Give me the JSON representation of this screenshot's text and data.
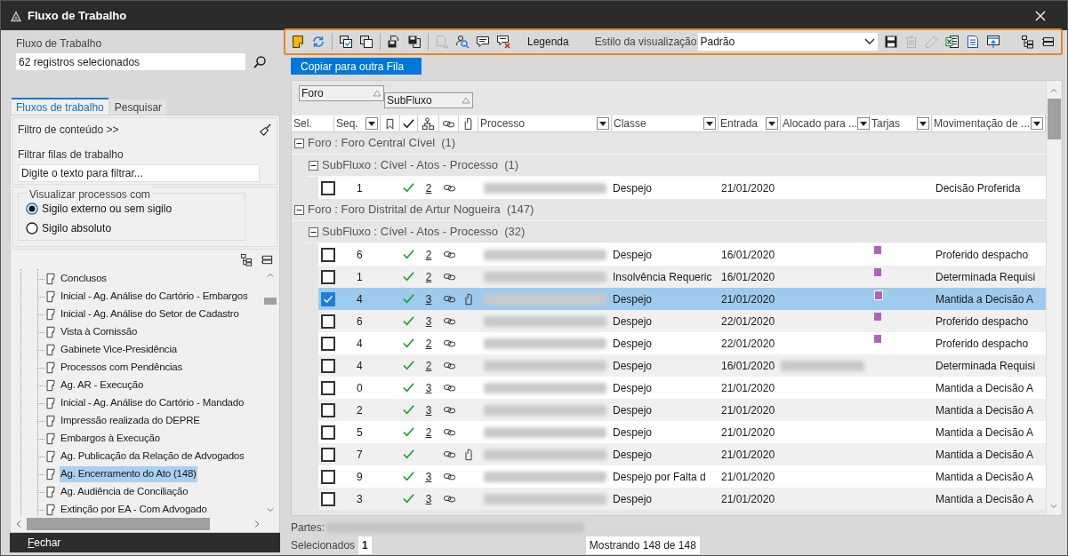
{
  "window": {
    "title": "Fluxo de Trabalho"
  },
  "left_panel": {
    "workflow_label": "Fluxo de Trabalho",
    "workflow_value": "62 registros selecionados",
    "tabs": [
      {
        "label": "Fluxos de trabalho",
        "selected": true
      },
      {
        "label": "Pesquisar",
        "selected": false
      }
    ],
    "content_filter": "Filtro de conteúdo >>",
    "queue_filter_label": "Filtrar filas de trabalho",
    "queue_filter": {
      "placeholder": "Digite o texto para filtrar..."
    },
    "visibility": {
      "legend": "Visualizar processos com",
      "options": [
        {
          "label": "Sigilo externo ou sem sigilo",
          "selected": true
        },
        {
          "label": "Sigilo absoluto",
          "selected": false
        }
      ]
    },
    "queues": [
      {
        "label": "Conclusos",
        "selected": false
      },
      {
        "label": "Inicial - Ag. Análise do Cartório - Embargos",
        "selected": false
      },
      {
        "label": "Inicial - Ag. Análise do Setor de Cadastro",
        "selected": false
      },
      {
        "label": "Vista à Comissão",
        "selected": false
      },
      {
        "label": "Gabinete Vice-Presidência",
        "selected": false
      },
      {
        "label": "Processos com Pendências",
        "selected": false
      },
      {
        "label": "Ag. AR - Execução",
        "selected": false
      },
      {
        "label": "Inicial - Ag. Análise do Cartório - Mandado",
        "selected": false
      },
      {
        "label": "Impressão realizada do DEPRE",
        "selected": false
      },
      {
        "label": "Embargos à Execução",
        "selected": false
      },
      {
        "label": "Ag. Publicação da Relação de Advogados",
        "selected": false
      },
      {
        "label": "Ag. Encerramento do Ato (148)",
        "selected": true
      },
      {
        "label": "Ag. Audiência de Conciliação",
        "selected": false
      },
      {
        "label": "Extinção por EA - Com Advogado",
        "selected": false
      }
    ],
    "close_button": "Fechar"
  },
  "toolbar": {
    "icons_left": [
      {
        "disabled": false
      },
      {
        "disabled": false
      },
      {
        "disabled": false
      },
      {
        "disabled": false
      },
      {
        "disabled": false
      },
      {
        "disabled": false
      },
      {
        "disabled": true
      },
      {
        "disabled": false
      },
      {
        "disabled": false
      },
      {
        "disabled": false
      }
    ],
    "legend_button": "Legenda",
    "style_label": "Estilo da visualização",
    "style_value": "Padrão",
    "icons_right": [
      {
        "disabled": false
      },
      {
        "disabled": true
      },
      {
        "disabled": true
      },
      {
        "disabled": false
      },
      {
        "disabled": false
      },
      {
        "disabled": false
      }
    ],
    "icons_far": [
      {
        "disabled": false
      },
      {
        "disabled": false
      }
    ]
  },
  "copy_button": "Copiar para outra Fila",
  "grouping": [
    "Foro",
    "SubFluxo"
  ],
  "table": {
    "columns": [
      {
        "kind": "text",
        "label": "Sel.",
        "filter": false
      },
      {
        "kind": "text",
        "label": "Seq.",
        "filter": true
      },
      {
        "kind": "icon"
      },
      {
        "kind": "icon"
      },
      {
        "kind": "icon"
      },
      {
        "kind": "icon"
      },
      {
        "kind": "icon"
      },
      {
        "kind": "text",
        "label": "Processo",
        "filter": true
      },
      {
        "kind": "text",
        "label": "Classe",
        "filter": true
      },
      {
        "kind": "text",
        "label": "Entrada",
        "filter": true
      },
      {
        "kind": "text",
        "label": "Alocado para ...",
        "filter": true
      },
      {
        "kind": "text",
        "label": "Tarjas",
        "filter": true
      },
      {
        "kind": "text",
        "label": "Movimentação de ...",
        "filter": true
      }
    ],
    "groups": [
      {
        "label": "Foro : Foro Central Cível",
        "count": "(1)",
        "expanded": true,
        "children": [
          {
            "label": "SubFluxo : Cível - Atos - Processo",
            "count": "(1)",
            "expanded": true,
            "rows": [
              {
                "seq": "1",
                "checked": false,
                "done": true,
                "volumes": "2",
                "linked": true,
                "attachment": false,
                "classe": "Despejo",
                "entrada": "21/01/2020",
                "allocated": false,
                "tarja": false,
                "movimentacao": "Decisão Proferida",
                "selected": false
              }
            ]
          }
        ]
      },
      {
        "label": "Foro : Foro Distrital de Artur Nogueira",
        "count": "(147)",
        "expanded": true,
        "children": [
          {
            "label": "SubFluxo : Cível - Atos - Processo",
            "count": "(32)",
            "expanded": true,
            "rows": [
              {
                "seq": "6",
                "checked": false,
                "done": true,
                "volumes": "2",
                "linked": true,
                "attachment": false,
                "classe": "Despejo",
                "entrada": "16/01/2020",
                "allocated": false,
                "tarja": true,
                "movimentacao": "Proferido despacho",
                "selected": false
              },
              {
                "seq": "1",
                "checked": false,
                "done": true,
                "volumes": "2",
                "linked": true,
                "attachment": false,
                "classe": "Insolvência Requeric",
                "entrada": "16/01/2020",
                "allocated": false,
                "tarja": true,
                "movimentacao": "Determinada Requisi",
                "selected": false
              },
              {
                "seq": "4",
                "checked": true,
                "done": true,
                "volumes": "3",
                "linked": true,
                "attachment": true,
                "classe": "Despejo",
                "entrada": "21/01/2020",
                "allocated": false,
                "tarja": true,
                "movimentacao": "Mantida a Decisão A",
                "selected": true
              },
              {
                "seq": "6",
                "checked": false,
                "done": true,
                "volumes": "3",
                "linked": true,
                "attachment": false,
                "classe": "Despejo",
                "entrada": "22/01/2020",
                "allocated": false,
                "tarja": true,
                "movimentacao": "Proferido despacho",
                "selected": false
              },
              {
                "seq": "4",
                "checked": false,
                "done": true,
                "volumes": "2",
                "linked": true,
                "attachment": false,
                "classe": "Despejo",
                "entrada": "22/01/2020",
                "allocated": false,
                "tarja": true,
                "movimentacao": "Proferido despacho",
                "selected": false
              },
              {
                "seq": "4",
                "checked": false,
                "done": true,
                "volumes": "2",
                "linked": true,
                "attachment": false,
                "classe": "Despejo",
                "entrada": "16/01/2020",
                "allocated": true,
                "tarja": false,
                "movimentacao": "Determinada Requisi",
                "selected": false
              },
              {
                "seq": "0",
                "checked": false,
                "done": true,
                "volumes": "3",
                "linked": true,
                "attachment": false,
                "classe": "Despejo",
                "entrada": "21/01/2020",
                "allocated": false,
                "tarja": false,
                "movimentacao": "Mantida a Decisão A",
                "selected": false
              },
              {
                "seq": "2",
                "checked": false,
                "done": true,
                "volumes": "3",
                "linked": true,
                "attachment": false,
                "classe": "Despejo",
                "entrada": "21/01/2020",
                "allocated": false,
                "tarja": false,
                "movimentacao": "Mantida a Decisão A",
                "selected": false
              },
              {
                "seq": "5",
                "checked": false,
                "done": true,
                "volumes": "2",
                "linked": true,
                "attachment": false,
                "classe": "Despejo",
                "entrada": "21/01/2020",
                "allocated": false,
                "tarja": false,
                "movimentacao": "Mantida a Decisão A",
                "selected": false
              },
              {
                "seq": "7",
                "checked": false,
                "done": true,
                "linked": true,
                "attachment": true,
                "classe": "Despejo",
                "entrada": "21/01/2020",
                "allocated": false,
                "tarja": false,
                "movimentacao": "Mantida a Decisão A",
                "selected": false
              },
              {
                "seq": "9",
                "checked": false,
                "done": true,
                "volumes": "3",
                "linked": true,
                "attachment": false,
                "classe": "Despejo por Falta d",
                "entrada": "21/01/2020",
                "allocated": false,
                "tarja": false,
                "movimentacao": "Mantida a Decisão A",
                "selected": false
              },
              {
                "seq": "3",
                "checked": false,
                "done": true,
                "volumes": "3",
                "linked": true,
                "attachment": false,
                "classe": "Despejo",
                "entrada": "21/01/2020",
                "allocated": false,
                "tarja": false,
                "movimentacao": "Mantida a Decisão A",
                "selected": false
              }
            ]
          }
        ]
      }
    ]
  },
  "footer": {
    "parts_label": "Partes:",
    "selected_label": "Selecionados",
    "selected_count": "1",
    "showing": "Mostrando 148 de 148"
  }
}
